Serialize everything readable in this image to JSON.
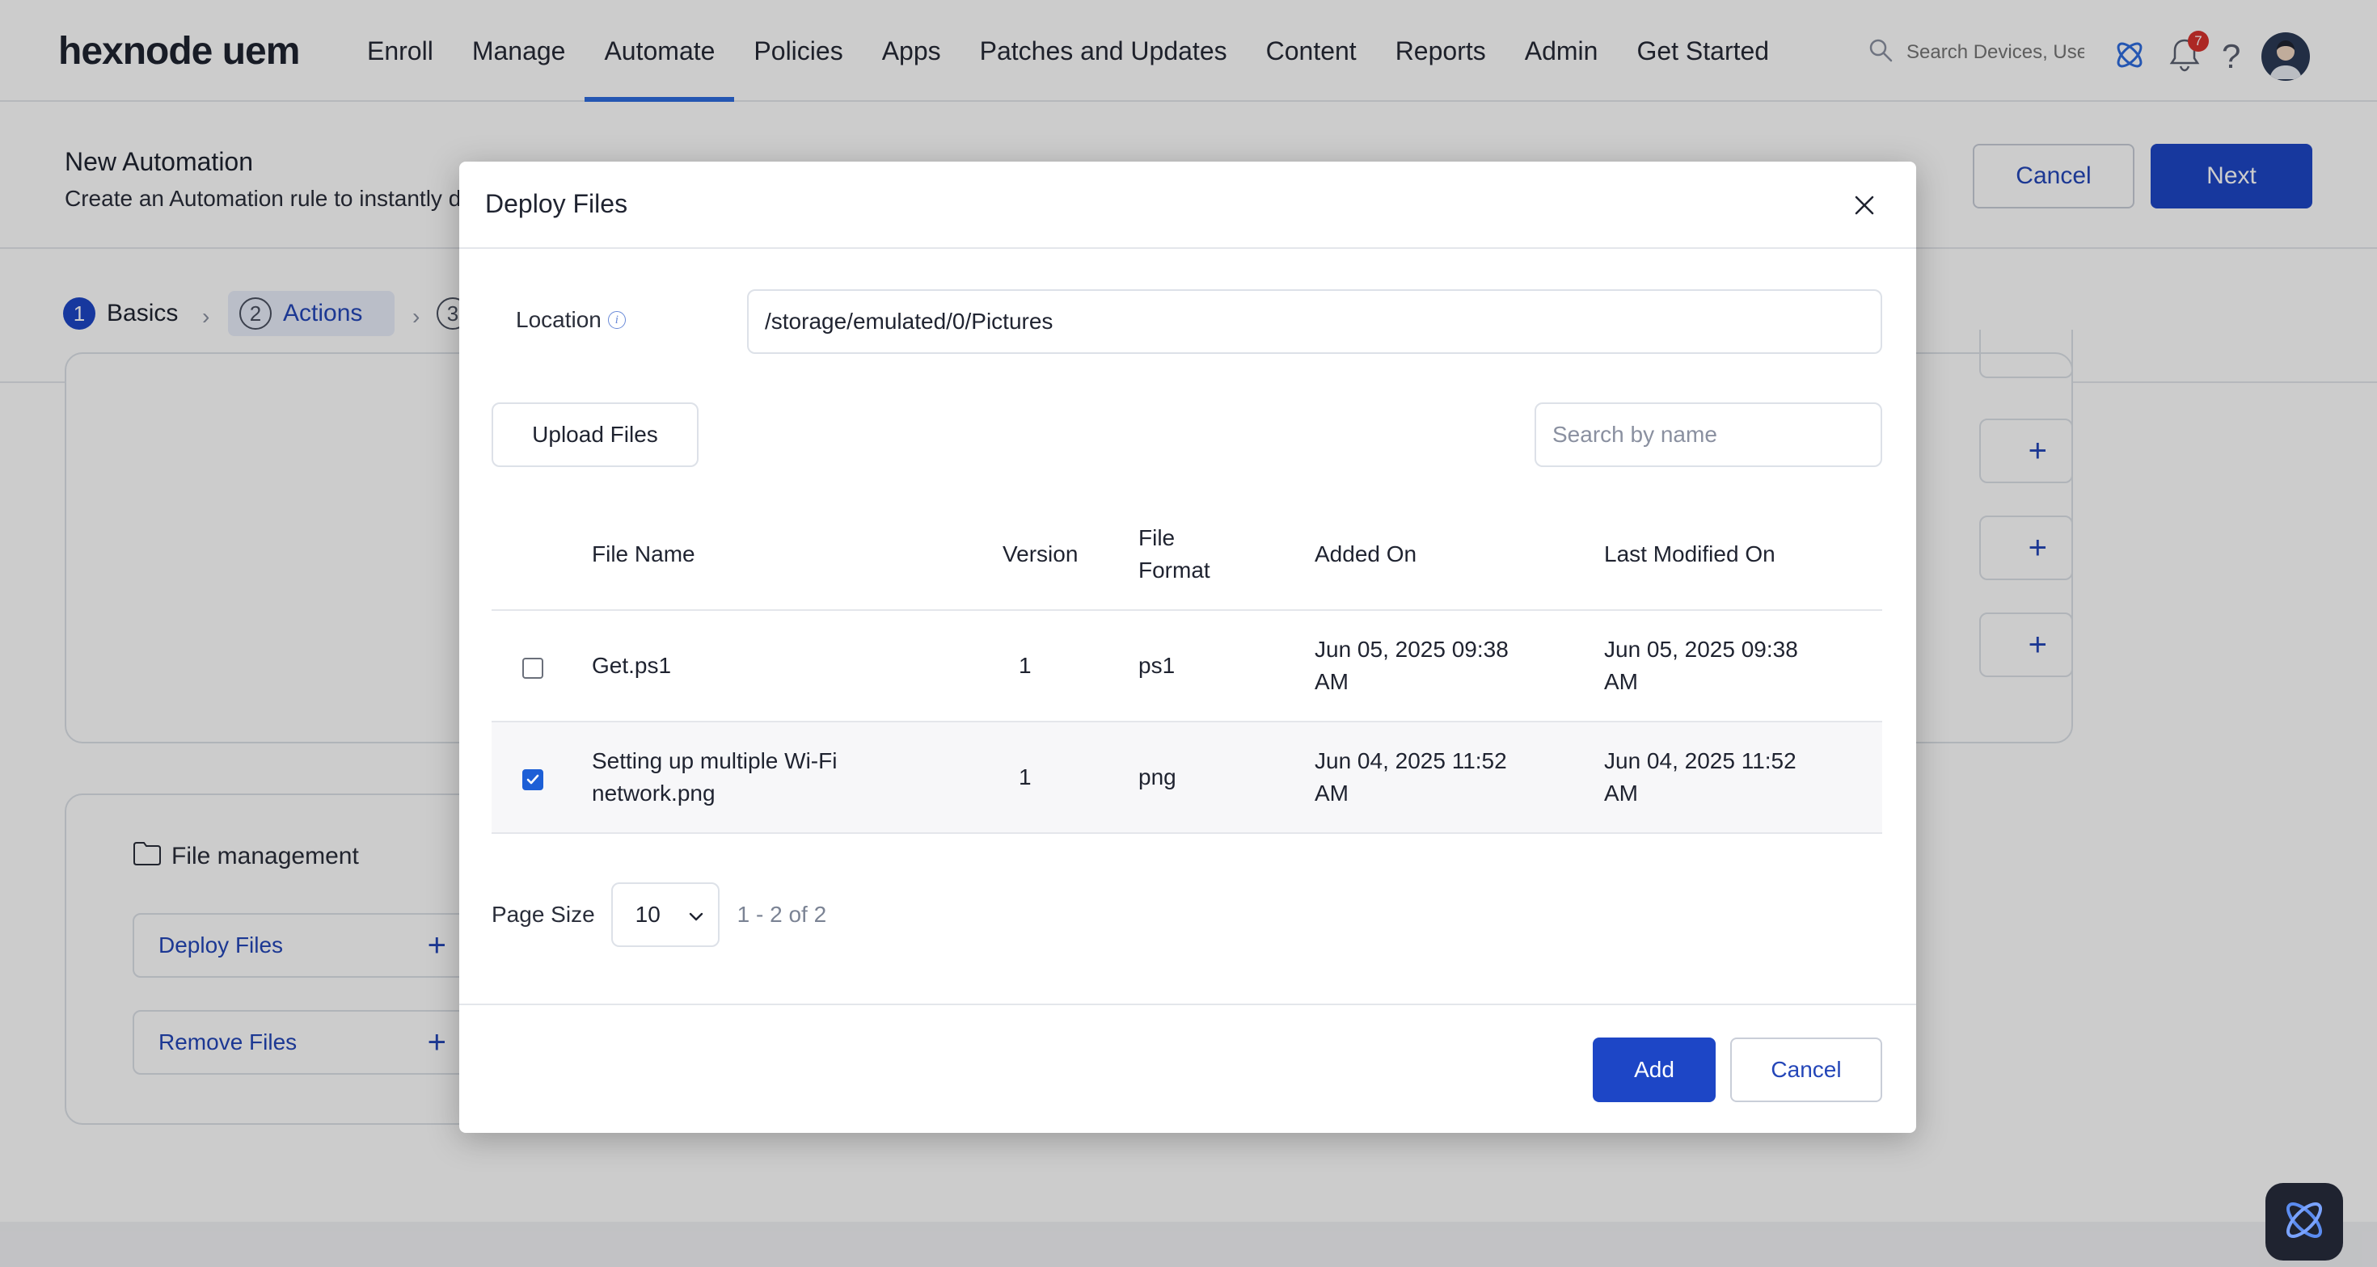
{
  "app": {
    "logo": "hexnode uem"
  },
  "nav": {
    "items": [
      {
        "label": "Enroll"
      },
      {
        "label": "Manage"
      },
      {
        "label": "Automate",
        "active": true
      },
      {
        "label": "Policies"
      },
      {
        "label": "Apps"
      },
      {
        "label": "Patches and Updates"
      },
      {
        "label": "Content"
      },
      {
        "label": "Reports"
      },
      {
        "label": "Admin"
      },
      {
        "label": "Get Started"
      }
    ],
    "search_placeholder": "Search Devices, Use",
    "notification_count": "7",
    "help_label": "?"
  },
  "header": {
    "title": "New Automation",
    "subtitle": "Create an Automation rule to instantly d",
    "cancel_label": "Cancel",
    "next_label": "Next"
  },
  "steps": [
    {
      "num": "1",
      "label": "Basics"
    },
    {
      "num": "2",
      "label": "Actions"
    },
    {
      "num": "3",
      "label": ""
    }
  ],
  "file_management": {
    "title": "File management",
    "actions": [
      {
        "label": "Deploy Files"
      },
      {
        "label": "Remove Files"
      }
    ]
  },
  "modal": {
    "title": "Deploy Files",
    "location_label": "Location",
    "location_value": "/storage/emulated/0/Pictures",
    "upload_label": "Upload Files",
    "search_placeholder": "Search by name",
    "columns": {
      "file_name": "File Name",
      "version": "Version",
      "format_line1": "File",
      "format_line2": "Format",
      "added_on": "Added On",
      "modified_on": "Last Modified On"
    },
    "rows": [
      {
        "checked": false,
        "name_line1": "Get.ps1",
        "name_line2": "",
        "version": "1",
        "format": "ps1",
        "added_line1": "Jun 05, 2025 09:38",
        "added_line2": "AM",
        "modified_line1": "Jun 05, 2025 09:38",
        "modified_line2": "AM"
      },
      {
        "checked": true,
        "name_line1": "Setting up multiple Wi-Fi",
        "name_line2": "network.png",
        "version": "1",
        "format": "png",
        "added_line1": "Jun 04, 2025 11:52",
        "added_line2": "AM",
        "modified_line1": "Jun 04, 2025 11:52",
        "modified_line2": "AM"
      }
    ],
    "pager": {
      "label": "Page Size",
      "size": "10",
      "range": "1 - 2 of 2"
    },
    "add_label": "Add",
    "cancel_label": "Cancel"
  },
  "colors": {
    "primary": "#1d46c6",
    "link": "#2446b8",
    "badge": "#d8322e"
  },
  "icons": {
    "search": "search-icon",
    "app_switch": "hexnode-logo-icon",
    "bell": "bell-icon",
    "close": "close-icon",
    "info": "info-icon",
    "folder": "folder-icon",
    "plus": "plus-icon",
    "chevron": "chevron-down-icon"
  }
}
